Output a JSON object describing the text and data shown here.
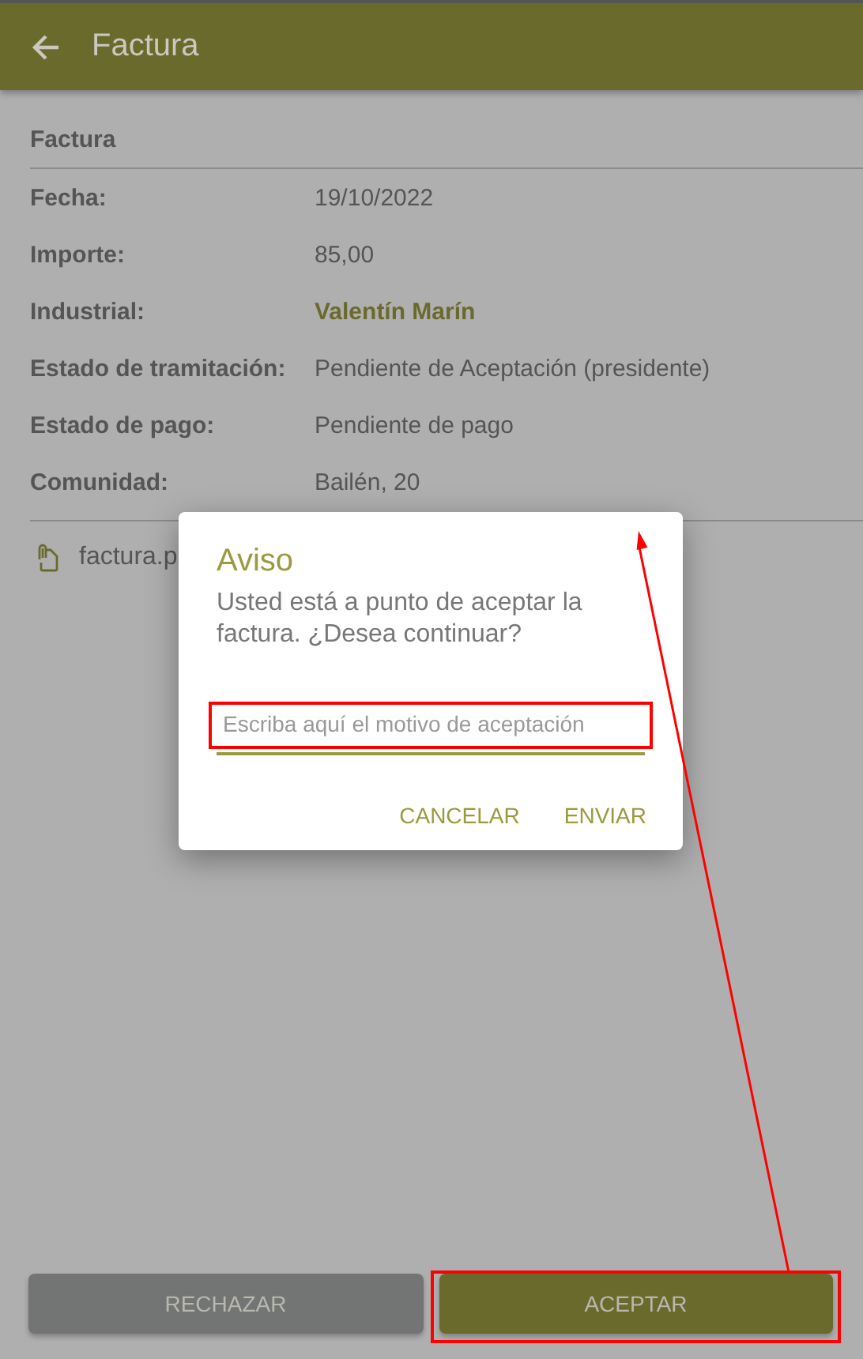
{
  "app_bar": {
    "title": "Factura"
  },
  "section_title": "Factura",
  "fields": [
    {
      "label": "Fecha:",
      "value": "19/10/2022",
      "kind": "text"
    },
    {
      "label": "Importe:",
      "value": "85,00",
      "kind": "text"
    },
    {
      "label": "Industrial:",
      "value": "Valentín Marín",
      "kind": "link"
    },
    {
      "label": "Estado de tramitación:",
      "value": "Pendiente de Aceptación (presidente)",
      "kind": "text"
    },
    {
      "label": "Estado de pago:",
      "value": "Pendiente de pago",
      "kind": "text"
    },
    {
      "label": "Comunidad:",
      "value": "Bailén, 20",
      "kind": "text"
    }
  ],
  "attachment": {
    "name": "factura.p"
  },
  "dialog": {
    "title": "Aviso",
    "message": "Usted está a punto de aceptar la factura. ¿Desea continuar?",
    "input": {
      "placeholder": "Escriba aquí el motivo de aceptación"
    },
    "actions": [
      "CANCELAR",
      "ENVIAR"
    ]
  },
  "buttons": [
    {
      "label": "RECHAZAR",
      "kind": "secondary"
    },
    {
      "label": "ACEPTAR",
      "kind": "primary"
    }
  ]
}
